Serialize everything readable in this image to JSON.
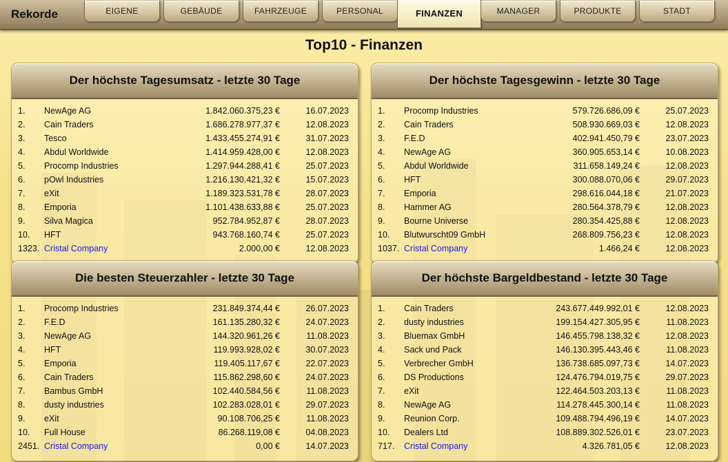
{
  "topbar": {
    "brand": "Rekorde",
    "tabs": [
      {
        "label": "EIGENE"
      },
      {
        "label": "GEBÄUDE"
      },
      {
        "label": "FAHRZEUGE"
      },
      {
        "label": "PERSONAL"
      },
      {
        "label": "FINANZEN",
        "active": true
      },
      {
        "label": "MANAGER"
      },
      {
        "label": "PRODUKTE"
      },
      {
        "label": "STADT"
      }
    ]
  },
  "page_title": "Top10 - Finanzen",
  "panels": [
    {
      "title": "Der höchste Tagesumsatz - letzte 30 Tage",
      "rows": [
        {
          "rank": "1.",
          "name": "NewAge AG",
          "value": "1.842.060.375,23 €",
          "date": "16.07.2023"
        },
        {
          "rank": "2.",
          "name": "Cain Traders",
          "value": "1.686.278.977,37 €",
          "date": "12.08.2023"
        },
        {
          "rank": "3.",
          "name": "Tesco",
          "value": "1.433.455.274,91 €",
          "date": "31.07.2023"
        },
        {
          "rank": "4.",
          "name": "Abdul Worldwide",
          "value": "1.414.959.428,00 €",
          "date": "12.08.2023"
        },
        {
          "rank": "5.",
          "name": "Procomp Industries",
          "value": "1.297.944.288,41 €",
          "date": "25.07.2023"
        },
        {
          "rank": "6.",
          "name": "pOwl Industries",
          "value": "1.216.130.421,32 €",
          "date": "15.07.2023"
        },
        {
          "rank": "7.",
          "name": "eXit",
          "value": "1.189.323.531,78 €",
          "date": "28.07.2023"
        },
        {
          "rank": "8.",
          "name": "Emporia",
          "value": "1.101.438.633,88 €",
          "date": "25.07.2023"
        },
        {
          "rank": "9.",
          "name": "Silva Magica",
          "value": "952.784.952,87 €",
          "date": "28.07.2023"
        },
        {
          "rank": "10.",
          "name": "HFT",
          "value": "943.768.160,74 €",
          "date": "25.07.2023"
        },
        {
          "rank": "1323.",
          "name": "Cristal Company",
          "value": "2.000,00 €",
          "date": "12.08.2023",
          "own": true
        }
      ]
    },
    {
      "title": "Der höchste Tagesgewinn - letzte 30 Tage",
      "rows": [
        {
          "rank": "1.",
          "name": "Procomp Industries",
          "value": "579.726.686,09 €",
          "date": "25.07.2023"
        },
        {
          "rank": "2.",
          "name": "Cain Traders",
          "value": "508.930.669,03 €",
          "date": "12.08.2023"
        },
        {
          "rank": "3.",
          "name": "F.E.D",
          "value": "402.941.450,79 €",
          "date": "23.07.2023"
        },
        {
          "rank": "4.",
          "name": "NewAge AG",
          "value": "360.905.653,14 €",
          "date": "10.08.2023"
        },
        {
          "rank": "5.",
          "name": "Abdul Worldwide",
          "value": "311.658.149,24 €",
          "date": "12.08.2023"
        },
        {
          "rank": "6.",
          "name": "HFT",
          "value": "300.088.070,06 €",
          "date": "29.07.2023"
        },
        {
          "rank": "7.",
          "name": "Emporia",
          "value": "298.616.044,18 €",
          "date": "21.07.2023"
        },
        {
          "rank": "8.",
          "name": "Hammer AG",
          "value": "280.564.378,79 €",
          "date": "12.08.2023"
        },
        {
          "rank": "9.",
          "name": "Bourne Universe",
          "value": "280.354.425,88 €",
          "date": "12.08.2023"
        },
        {
          "rank": "10.",
          "name": "Blutwurscht09 GmbH",
          "value": "268.809.756,23 €",
          "date": "12.08.2023"
        },
        {
          "rank": "1037.",
          "name": "Cristal Company",
          "value": "1.466,24 €",
          "date": "12.08.2023",
          "own": true
        }
      ]
    },
    {
      "title": "Die besten Steuerzahler - letzte 30 Tage",
      "rows": [
        {
          "rank": "1.",
          "name": "Procomp Industries",
          "value": "231.849.374,44 €",
          "date": "26.07.2023"
        },
        {
          "rank": "2.",
          "name": "F.E.D",
          "value": "161.135.280,32 €",
          "date": "24.07.2023"
        },
        {
          "rank": "3.",
          "name": "NewAge AG",
          "value": "144.320.961,26 €",
          "date": "11.08.2023"
        },
        {
          "rank": "4.",
          "name": "HFT",
          "value": "119.993.928,02 €",
          "date": "30.07.2023"
        },
        {
          "rank": "5.",
          "name": "Emporia",
          "value": "119.405.117,67 €",
          "date": "22.07.2023"
        },
        {
          "rank": "6.",
          "name": "Cain Traders",
          "value": "115.862.298,60 €",
          "date": "24.07.2023"
        },
        {
          "rank": "7.",
          "name": "Bambus GmbH",
          "value": "102.440.584,56 €",
          "date": "11.08.2023"
        },
        {
          "rank": "8.",
          "name": "dusty industries",
          "value": "102.283.028,01 €",
          "date": "29.07.2023"
        },
        {
          "rank": "9.",
          "name": "eXit",
          "value": "90.108.706,25 €",
          "date": "11.08.2023"
        },
        {
          "rank": "10.",
          "name": "Full House",
          "value": "86.268.119,08 €",
          "date": "04.08.2023"
        },
        {
          "rank": "2451.",
          "name": "Cristal Company",
          "value": "0,00 €",
          "date": "14.07.2023",
          "own": true
        }
      ]
    },
    {
      "title": "Der höchste Bargeldbestand - letzte 30 Tage",
      "rows": [
        {
          "rank": "1.",
          "name": "Cain Traders",
          "value": "243.677.449.992,01 €",
          "date": "12.08.2023"
        },
        {
          "rank": "2.",
          "name": "dusty industries",
          "value": "199.154.427.305,95 €",
          "date": "11.08.2023"
        },
        {
          "rank": "3.",
          "name": "Bluemax GmbH",
          "value": "146.455.798.138,32 €",
          "date": "12.08.2023"
        },
        {
          "rank": "4.",
          "name": "Sack und Pack",
          "value": "146.130.395.443,46 €",
          "date": "11.08.2023"
        },
        {
          "rank": "5.",
          "name": "Verbrecher GmbH",
          "value": "136.738.685.097,73 €",
          "date": "14.07.2023"
        },
        {
          "rank": "6.",
          "name": "DS Productions",
          "value": "124.476.794.019,75 €",
          "date": "29.07.2023"
        },
        {
          "rank": "7.",
          "name": "eXit",
          "value": "122.464.503.203,13 €",
          "date": "11.08.2023"
        },
        {
          "rank": "8.",
          "name": "NewAge AG",
          "value": "114.278.445.300,14 €",
          "date": "11.08.2023"
        },
        {
          "rank": "9.",
          "name": "Reunion Corp.",
          "value": "109.488.794.496,19 €",
          "date": "14.07.2023"
        },
        {
          "rank": "10.",
          "name": "Dealers Ltd",
          "value": "108.889.302.526,01 €",
          "date": "23.07.2023"
        },
        {
          "rank": "717.",
          "name": "Cristal Company",
          "value": "4.326.781,05 €",
          "date": "12.08.2023",
          "own": true
        }
      ]
    }
  ]
}
